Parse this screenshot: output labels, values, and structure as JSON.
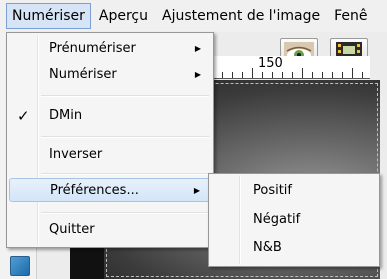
{
  "menubar": {
    "items": [
      {
        "label": "Numériser",
        "open": true
      },
      {
        "label": "Aperçu"
      },
      {
        "label": "Ajustement de l'image"
      },
      {
        "label": "Fenê"
      }
    ]
  },
  "ruler": {
    "label": "150"
  },
  "toolbar": {
    "buttons": [
      {
        "icon": "eye-icon"
      },
      {
        "icon": "film-strip-icon"
      }
    ]
  },
  "menu": {
    "items": [
      {
        "label": "Prénumériser",
        "submenu": true
      },
      {
        "label": "Numériser",
        "submenu": true
      },
      {
        "label": "DMin",
        "checked": true
      },
      {
        "label": "Inverser"
      },
      {
        "label": "Préférences...",
        "submenu": true,
        "highlighted": true
      },
      {
        "label": "Quitter"
      }
    ]
  },
  "submenu": {
    "items": [
      {
        "label": "Positif"
      },
      {
        "label": "Négatif"
      },
      {
        "label": "N&B"
      }
    ]
  },
  "colors": {
    "highlight": "#d3e5f8",
    "highlight_border": "#a7c4e6",
    "menu_bg": "#f5f5f5"
  }
}
